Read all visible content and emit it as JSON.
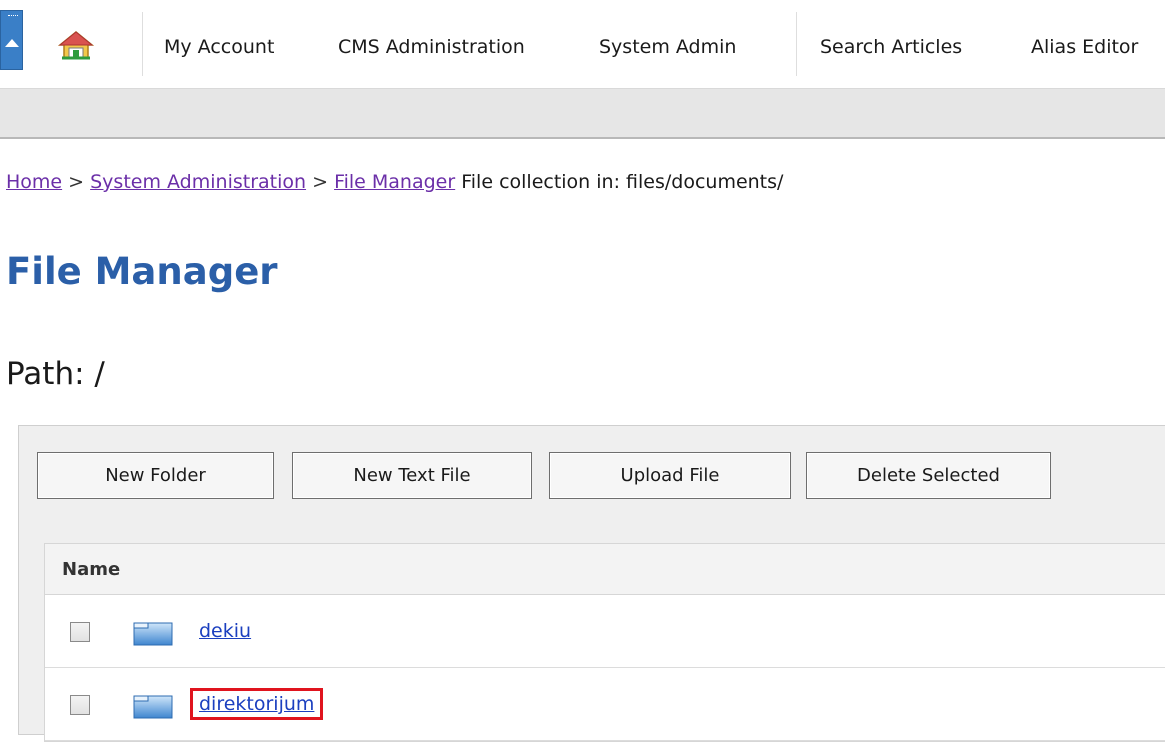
{
  "nav": {
    "collapse_icon": "collapse-arrow-icon",
    "home_icon": "home-icon",
    "items": [
      {
        "label": "My Account"
      },
      {
        "label": "CMS Administration"
      },
      {
        "label": "System Admin"
      },
      {
        "label": "Search Articles"
      },
      {
        "label": "Alias Editor"
      }
    ]
  },
  "breadcrumb": {
    "home": "Home",
    "sep1": ">",
    "system_admin": "System Administration",
    "sep2": ">",
    "file_manager": "File Manager",
    "trail_text": "File collection in: files/documents/"
  },
  "page": {
    "title": "File Manager",
    "path_label": "Path: /"
  },
  "toolbar": {
    "new_folder": "New Folder",
    "new_text_file": "New Text File",
    "upload_file": "Upload File",
    "delete_selected": "Delete Selected"
  },
  "table": {
    "columns": [
      {
        "label": "Name"
      }
    ],
    "rows": [
      {
        "name": "dekiu",
        "icon": "folder-icon",
        "checked": false
      },
      {
        "name": "direktorijum",
        "icon": "folder-icon",
        "checked": false,
        "highlighted": true
      }
    ]
  },
  "colors": {
    "title_blue": "#2b5fa8",
    "link_blue": "#1b3fbf",
    "visited_link": "#6b2fa8",
    "highlight_red": "#e0141e"
  }
}
